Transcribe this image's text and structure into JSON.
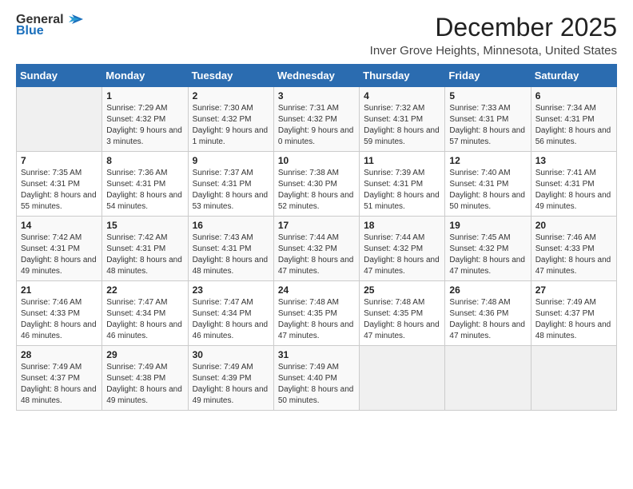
{
  "header": {
    "logo_general": "General",
    "logo_blue": "Blue",
    "month_title": "December 2025",
    "location": "Inver Grove Heights, Minnesota, United States"
  },
  "weekdays": [
    "Sunday",
    "Monday",
    "Tuesday",
    "Wednesday",
    "Thursday",
    "Friday",
    "Saturday"
  ],
  "weeks": [
    [
      {
        "day": "",
        "sunrise": "",
        "sunset": "",
        "daylight": "",
        "empty": true
      },
      {
        "day": "1",
        "sunrise": "Sunrise: 7:29 AM",
        "sunset": "Sunset: 4:32 PM",
        "daylight": "Daylight: 9 hours and 3 minutes."
      },
      {
        "day": "2",
        "sunrise": "Sunrise: 7:30 AM",
        "sunset": "Sunset: 4:32 PM",
        "daylight": "Daylight: 9 hours and 1 minute."
      },
      {
        "day": "3",
        "sunrise": "Sunrise: 7:31 AM",
        "sunset": "Sunset: 4:32 PM",
        "daylight": "Daylight: 9 hours and 0 minutes."
      },
      {
        "day": "4",
        "sunrise": "Sunrise: 7:32 AM",
        "sunset": "Sunset: 4:31 PM",
        "daylight": "Daylight: 8 hours and 59 minutes."
      },
      {
        "day": "5",
        "sunrise": "Sunrise: 7:33 AM",
        "sunset": "Sunset: 4:31 PM",
        "daylight": "Daylight: 8 hours and 57 minutes."
      },
      {
        "day": "6",
        "sunrise": "Sunrise: 7:34 AM",
        "sunset": "Sunset: 4:31 PM",
        "daylight": "Daylight: 8 hours and 56 minutes."
      }
    ],
    [
      {
        "day": "7",
        "sunrise": "Sunrise: 7:35 AM",
        "sunset": "Sunset: 4:31 PM",
        "daylight": "Daylight: 8 hours and 55 minutes."
      },
      {
        "day": "8",
        "sunrise": "Sunrise: 7:36 AM",
        "sunset": "Sunset: 4:31 PM",
        "daylight": "Daylight: 8 hours and 54 minutes."
      },
      {
        "day": "9",
        "sunrise": "Sunrise: 7:37 AM",
        "sunset": "Sunset: 4:31 PM",
        "daylight": "Daylight: 8 hours and 53 minutes."
      },
      {
        "day": "10",
        "sunrise": "Sunrise: 7:38 AM",
        "sunset": "Sunset: 4:30 PM",
        "daylight": "Daylight: 8 hours and 52 minutes."
      },
      {
        "day": "11",
        "sunrise": "Sunrise: 7:39 AM",
        "sunset": "Sunset: 4:31 PM",
        "daylight": "Daylight: 8 hours and 51 minutes."
      },
      {
        "day": "12",
        "sunrise": "Sunrise: 7:40 AM",
        "sunset": "Sunset: 4:31 PM",
        "daylight": "Daylight: 8 hours and 50 minutes."
      },
      {
        "day": "13",
        "sunrise": "Sunrise: 7:41 AM",
        "sunset": "Sunset: 4:31 PM",
        "daylight": "Daylight: 8 hours and 49 minutes."
      }
    ],
    [
      {
        "day": "14",
        "sunrise": "Sunrise: 7:42 AM",
        "sunset": "Sunset: 4:31 PM",
        "daylight": "Daylight: 8 hours and 49 minutes."
      },
      {
        "day": "15",
        "sunrise": "Sunrise: 7:42 AM",
        "sunset": "Sunset: 4:31 PM",
        "daylight": "Daylight: 8 hours and 48 minutes."
      },
      {
        "day": "16",
        "sunrise": "Sunrise: 7:43 AM",
        "sunset": "Sunset: 4:31 PM",
        "daylight": "Daylight: 8 hours and 48 minutes."
      },
      {
        "day": "17",
        "sunrise": "Sunrise: 7:44 AM",
        "sunset": "Sunset: 4:32 PM",
        "daylight": "Daylight: 8 hours and 47 minutes."
      },
      {
        "day": "18",
        "sunrise": "Sunrise: 7:44 AM",
        "sunset": "Sunset: 4:32 PM",
        "daylight": "Daylight: 8 hours and 47 minutes."
      },
      {
        "day": "19",
        "sunrise": "Sunrise: 7:45 AM",
        "sunset": "Sunset: 4:32 PM",
        "daylight": "Daylight: 8 hours and 47 minutes."
      },
      {
        "day": "20",
        "sunrise": "Sunrise: 7:46 AM",
        "sunset": "Sunset: 4:33 PM",
        "daylight": "Daylight: 8 hours and 47 minutes."
      }
    ],
    [
      {
        "day": "21",
        "sunrise": "Sunrise: 7:46 AM",
        "sunset": "Sunset: 4:33 PM",
        "daylight": "Daylight: 8 hours and 46 minutes."
      },
      {
        "day": "22",
        "sunrise": "Sunrise: 7:47 AM",
        "sunset": "Sunset: 4:34 PM",
        "daylight": "Daylight: 8 hours and 46 minutes."
      },
      {
        "day": "23",
        "sunrise": "Sunrise: 7:47 AM",
        "sunset": "Sunset: 4:34 PM",
        "daylight": "Daylight: 8 hours and 46 minutes."
      },
      {
        "day": "24",
        "sunrise": "Sunrise: 7:48 AM",
        "sunset": "Sunset: 4:35 PM",
        "daylight": "Daylight: 8 hours and 47 minutes."
      },
      {
        "day": "25",
        "sunrise": "Sunrise: 7:48 AM",
        "sunset": "Sunset: 4:35 PM",
        "daylight": "Daylight: 8 hours and 47 minutes."
      },
      {
        "day": "26",
        "sunrise": "Sunrise: 7:48 AM",
        "sunset": "Sunset: 4:36 PM",
        "daylight": "Daylight: 8 hours and 47 minutes."
      },
      {
        "day": "27",
        "sunrise": "Sunrise: 7:49 AM",
        "sunset": "Sunset: 4:37 PM",
        "daylight": "Daylight: 8 hours and 48 minutes."
      }
    ],
    [
      {
        "day": "28",
        "sunrise": "Sunrise: 7:49 AM",
        "sunset": "Sunset: 4:37 PM",
        "daylight": "Daylight: 8 hours and 48 minutes."
      },
      {
        "day": "29",
        "sunrise": "Sunrise: 7:49 AM",
        "sunset": "Sunset: 4:38 PM",
        "daylight": "Daylight: 8 hours and 49 minutes."
      },
      {
        "day": "30",
        "sunrise": "Sunrise: 7:49 AM",
        "sunset": "Sunset: 4:39 PM",
        "daylight": "Daylight: 8 hours and 49 minutes."
      },
      {
        "day": "31",
        "sunrise": "Sunrise: 7:49 AM",
        "sunset": "Sunset: 4:40 PM",
        "daylight": "Daylight: 8 hours and 50 minutes."
      },
      {
        "day": "",
        "sunrise": "",
        "sunset": "",
        "daylight": "",
        "empty": true
      },
      {
        "day": "",
        "sunrise": "",
        "sunset": "",
        "daylight": "",
        "empty": true
      },
      {
        "day": "",
        "sunrise": "",
        "sunset": "",
        "daylight": "",
        "empty": true
      }
    ]
  ]
}
